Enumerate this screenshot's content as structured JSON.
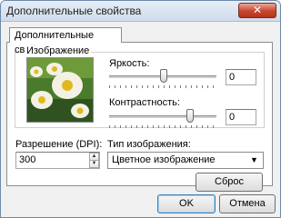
{
  "window": {
    "title": "Дополнительные свойства",
    "close_label": "✕"
  },
  "tab": {
    "label": "Дополнительные свойства"
  },
  "image_group": {
    "legend": "Изображение",
    "brightness": {
      "label": "Яркость:",
      "value": "0"
    },
    "contrast": {
      "label": "Контрастность:",
      "value": "0"
    }
  },
  "resolution": {
    "label": "Разрешение (DPI):",
    "value": "300"
  },
  "image_type": {
    "label": "Тип изображения:",
    "selected": "Цветное изображение"
  },
  "buttons": {
    "reset": "Сброс",
    "ok": "OK",
    "cancel": "Отмена"
  },
  "icons": {
    "spin_up": "▲",
    "spin_down": "▼",
    "dropdown": "▼"
  },
  "colors": {
    "close_button": "#c7462d",
    "default_button_border": "#3c7fb1"
  }
}
